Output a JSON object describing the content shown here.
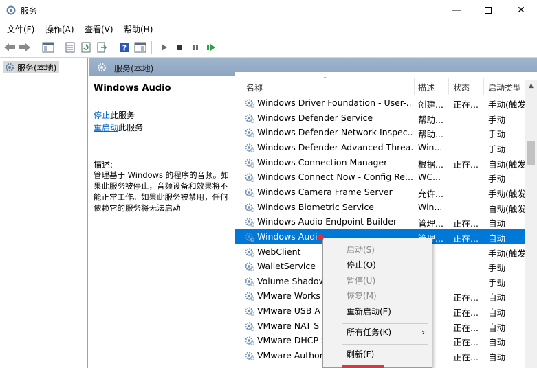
{
  "window": {
    "title": "服务"
  },
  "menu": [
    "文件(F)",
    "操作(A)",
    "查看(V)",
    "帮助(H)"
  ],
  "tree": {
    "root_label": "服务(本地)"
  },
  "pane": {
    "header": "服务(本地)"
  },
  "detail": {
    "service_name": "Windows Audio",
    "stop_link": "停止",
    "stop_suffix": "此服务",
    "restart_link": "重启动",
    "restart_suffix": "此服务",
    "desc_label": "描述:",
    "desc_text": "管理基于 Windows 的程序的音频。如果此服务被停止，音频设备和效果将不能正常工作。如果此服务被禁用，任何依赖它的服务将无法启动"
  },
  "columns": {
    "name": "名称",
    "desc": "描述",
    "state": "状态",
    "start": "启动类型"
  },
  "services": [
    {
      "name": "Windows Driver Foundation - User-...",
      "desc": "创建...",
      "state": "正在...",
      "start": "手动(触发"
    },
    {
      "name": "Windows Defender Service",
      "desc": "帮助...",
      "state": "",
      "start": "手动"
    },
    {
      "name": "Windows Defender Network Inspec...",
      "desc": "帮助...",
      "state": "",
      "start": "手动"
    },
    {
      "name": "Windows Defender Advanced Threa...",
      "desc": "Win...",
      "state": "",
      "start": "手动"
    },
    {
      "name": "Windows Connection Manager",
      "desc": "根据...",
      "state": "正在...",
      "start": "自动(触发"
    },
    {
      "name": "Windows Connect Now - Config Re...",
      "desc": "WC...",
      "state": "",
      "start": "手动"
    },
    {
      "name": "Windows Camera Frame Server",
      "desc": "允许...",
      "state": "",
      "start": "手动(触发"
    },
    {
      "name": "Windows Biometric Service",
      "desc": "Win...",
      "state": "",
      "start": "自动(触发"
    },
    {
      "name": "Windows Audio Endpoint Builder",
      "desc": "管理...",
      "state": "正在...",
      "start": "自动"
    },
    {
      "name": "Windows Audio",
      "desc": "管理...",
      "state": "正在...",
      "start": "自动"
    },
    {
      "name": "WebClient",
      "desc": "",
      "state": "",
      "start": "手动(触发"
    },
    {
      "name": "WalletService",
      "desc": "",
      "state": "",
      "start": "手动"
    },
    {
      "name": "Volume Shadow",
      "desc": "",
      "state": "",
      "start": "手动"
    },
    {
      "name": "VMware Works",
      "desc": "",
      "state": "正在...",
      "start": "自动"
    },
    {
      "name": "VMware USB A",
      "desc": "",
      "state": "正在...",
      "start": "自动"
    },
    {
      "name": "VMware NAT S",
      "desc": "",
      "state": "正在...",
      "start": "自动"
    },
    {
      "name": "VMware DHCP S",
      "desc": "",
      "state": "正在...",
      "start": "自动"
    },
    {
      "name": "VMware Author",
      "desc": "",
      "state": "正在...",
      "start": "自动"
    }
  ],
  "context_menu": {
    "start": "启动(S)",
    "stop": "停止(O)",
    "pause": "暂停(U)",
    "resume": "恢复(M)",
    "restart": "重新启动(E)",
    "all_tasks": "所有任务(K)",
    "refresh": "刷新(F)"
  },
  "colors": {
    "selection": "#0078d7",
    "pane_header": "#9fb4cc",
    "link": "#0066cc"
  }
}
